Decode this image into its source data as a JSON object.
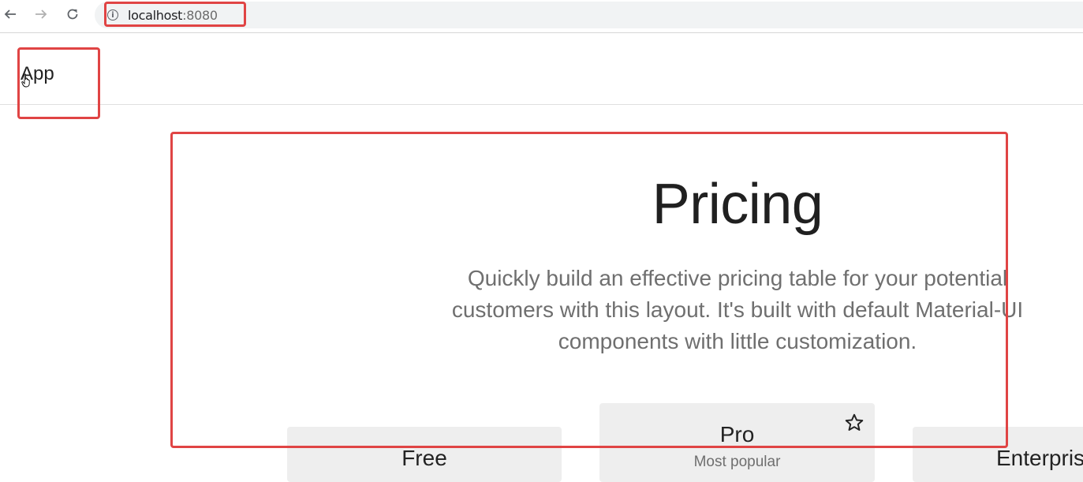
{
  "browser": {
    "url_host": "localhost",
    "url_port": ":8080",
    "icons": {
      "back": "arrow-left-icon",
      "forward": "arrow-right-icon",
      "reload": "reload-icon",
      "info": "info-icon"
    }
  },
  "app_bar": {
    "title": "App"
  },
  "hero": {
    "title": "Pricing",
    "subtitle": "Quickly build an effective pricing table for your potential customers with this layout. It's built with default Material-UI components with little customization."
  },
  "tiers": [
    {
      "title": "Free",
      "subheader": ""
    },
    {
      "title": "Pro",
      "subheader": "Most popular",
      "icon": "star-icon"
    },
    {
      "title": "Enterprise",
      "subheader": ""
    }
  ],
  "colors": {
    "highlight": "#e04444",
    "card_header": "#eeeeee",
    "subtitle_text": "#6f6f6f"
  }
}
